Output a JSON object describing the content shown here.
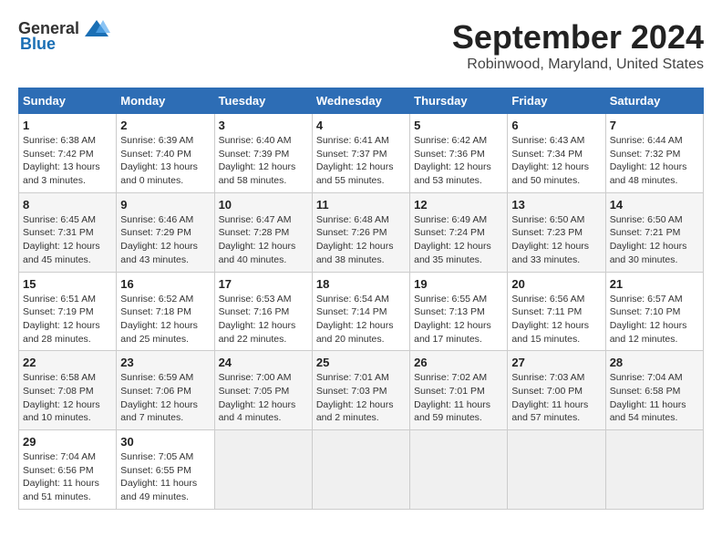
{
  "header": {
    "logo_general": "General",
    "logo_blue": "Blue",
    "title": "September 2024",
    "subtitle": "Robinwood, Maryland, United States"
  },
  "calendar": {
    "days_of_week": [
      "Sunday",
      "Monday",
      "Tuesday",
      "Wednesday",
      "Thursday",
      "Friday",
      "Saturday"
    ],
    "weeks": [
      [
        {
          "day": "1",
          "sunrise": "6:38 AM",
          "sunset": "7:42 PM",
          "daylight": "13 hours and 3 minutes."
        },
        {
          "day": "2",
          "sunrise": "6:39 AM",
          "sunset": "7:40 PM",
          "daylight": "13 hours and 0 minutes."
        },
        {
          "day": "3",
          "sunrise": "6:40 AM",
          "sunset": "7:39 PM",
          "daylight": "12 hours and 58 minutes."
        },
        {
          "day": "4",
          "sunrise": "6:41 AM",
          "sunset": "7:37 PM",
          "daylight": "12 hours and 55 minutes."
        },
        {
          "day": "5",
          "sunrise": "6:42 AM",
          "sunset": "7:36 PM",
          "daylight": "12 hours and 53 minutes."
        },
        {
          "day": "6",
          "sunrise": "6:43 AM",
          "sunset": "7:34 PM",
          "daylight": "12 hours and 50 minutes."
        },
        {
          "day": "7",
          "sunrise": "6:44 AM",
          "sunset": "7:32 PM",
          "daylight": "12 hours and 48 minutes."
        }
      ],
      [
        {
          "day": "8",
          "sunrise": "6:45 AM",
          "sunset": "7:31 PM",
          "daylight": "12 hours and 45 minutes."
        },
        {
          "day": "9",
          "sunrise": "6:46 AM",
          "sunset": "7:29 PM",
          "daylight": "12 hours and 43 minutes."
        },
        {
          "day": "10",
          "sunrise": "6:47 AM",
          "sunset": "7:28 PM",
          "daylight": "12 hours and 40 minutes."
        },
        {
          "day": "11",
          "sunrise": "6:48 AM",
          "sunset": "7:26 PM",
          "daylight": "12 hours and 38 minutes."
        },
        {
          "day": "12",
          "sunrise": "6:49 AM",
          "sunset": "7:24 PM",
          "daylight": "12 hours and 35 minutes."
        },
        {
          "day": "13",
          "sunrise": "6:50 AM",
          "sunset": "7:23 PM",
          "daylight": "12 hours and 33 minutes."
        },
        {
          "day": "14",
          "sunrise": "6:50 AM",
          "sunset": "7:21 PM",
          "daylight": "12 hours and 30 minutes."
        }
      ],
      [
        {
          "day": "15",
          "sunrise": "6:51 AM",
          "sunset": "7:19 PM",
          "daylight": "12 hours and 28 minutes."
        },
        {
          "day": "16",
          "sunrise": "6:52 AM",
          "sunset": "7:18 PM",
          "daylight": "12 hours and 25 minutes."
        },
        {
          "day": "17",
          "sunrise": "6:53 AM",
          "sunset": "7:16 PM",
          "daylight": "12 hours and 22 minutes."
        },
        {
          "day": "18",
          "sunrise": "6:54 AM",
          "sunset": "7:14 PM",
          "daylight": "12 hours and 20 minutes."
        },
        {
          "day": "19",
          "sunrise": "6:55 AM",
          "sunset": "7:13 PM",
          "daylight": "12 hours and 17 minutes."
        },
        {
          "day": "20",
          "sunrise": "6:56 AM",
          "sunset": "7:11 PM",
          "daylight": "12 hours and 15 minutes."
        },
        {
          "day": "21",
          "sunrise": "6:57 AM",
          "sunset": "7:10 PM",
          "daylight": "12 hours and 12 minutes."
        }
      ],
      [
        {
          "day": "22",
          "sunrise": "6:58 AM",
          "sunset": "7:08 PM",
          "daylight": "12 hours and 10 minutes."
        },
        {
          "day": "23",
          "sunrise": "6:59 AM",
          "sunset": "7:06 PM",
          "daylight": "12 hours and 7 minutes."
        },
        {
          "day": "24",
          "sunrise": "7:00 AM",
          "sunset": "7:05 PM",
          "daylight": "12 hours and 4 minutes."
        },
        {
          "day": "25",
          "sunrise": "7:01 AM",
          "sunset": "7:03 PM",
          "daylight": "12 hours and 2 minutes."
        },
        {
          "day": "26",
          "sunrise": "7:02 AM",
          "sunset": "7:01 PM",
          "daylight": "11 hours and 59 minutes."
        },
        {
          "day": "27",
          "sunrise": "7:03 AM",
          "sunset": "7:00 PM",
          "daylight": "11 hours and 57 minutes."
        },
        {
          "day": "28",
          "sunrise": "7:04 AM",
          "sunset": "6:58 PM",
          "daylight": "11 hours and 54 minutes."
        }
      ],
      [
        {
          "day": "29",
          "sunrise": "7:04 AM",
          "sunset": "6:56 PM",
          "daylight": "11 hours and 51 minutes."
        },
        {
          "day": "30",
          "sunrise": "7:05 AM",
          "sunset": "6:55 PM",
          "daylight": "11 hours and 49 minutes."
        },
        null,
        null,
        null,
        null,
        null
      ]
    ]
  }
}
